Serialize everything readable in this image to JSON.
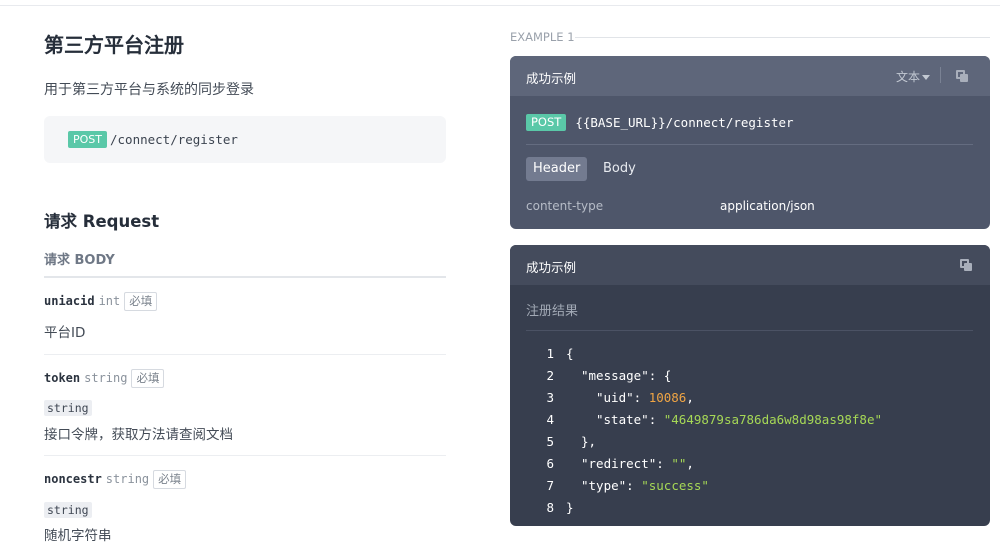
{
  "page": {
    "title": "第三方平台注册",
    "description": "用于第三方平台与系统的同步登录",
    "method": "POST",
    "path": "/connect/register",
    "request_title": "请求 Request",
    "body_label": "请求 BODY"
  },
  "params": [
    {
      "name": "uniacid",
      "type": "int",
      "required": "必填",
      "tag": "",
      "desc": "平台ID"
    },
    {
      "name": "token",
      "type": "string",
      "required": "必填",
      "tag": "string",
      "desc": "接口令牌，获取方法请查阅文档"
    },
    {
      "name": "noncestr",
      "type": "string",
      "required": "必填",
      "tag": "string",
      "desc": "随机字符串"
    }
  ],
  "example": {
    "label": "EXAMPLE 1",
    "card1": {
      "title": "成功示例",
      "format": "文本",
      "method": "POST",
      "url": "{{BASE_URL}}/connect/register",
      "tabs": [
        "Header",
        "Body"
      ],
      "header_key": "content-type",
      "header_value": "application/json"
    },
    "card2": {
      "title": "成功示例",
      "desc": "注册结果"
    }
  },
  "code_lines": [
    {
      "n": "1",
      "parts": [
        [
          "{",
          "k"
        ]
      ],
      "indent": 0
    },
    {
      "n": "2",
      "parts": [
        [
          "\"message\"",
          "k"
        ],
        [
          ": {",
          "k"
        ]
      ],
      "indent": 1
    },
    {
      "n": "3",
      "parts": [
        [
          "\"uid\"",
          "k"
        ],
        [
          ": ",
          "k"
        ],
        [
          "10086",
          "n"
        ],
        [
          ",",
          "k"
        ]
      ],
      "indent": 2
    },
    {
      "n": "4",
      "parts": [
        [
          "\"state\"",
          "k"
        ],
        [
          ": ",
          "k"
        ],
        [
          "\"4649879sa786da6w8d98as98f8e\"",
          "s"
        ]
      ],
      "indent": 2
    },
    {
      "n": "5",
      "parts": [
        [
          "},",
          "k"
        ]
      ],
      "indent": 1
    },
    {
      "n": "6",
      "parts": [
        [
          "\"redirect\"",
          "k"
        ],
        [
          ": ",
          "k"
        ],
        [
          "\"\"",
          "s"
        ],
        [
          ",",
          "k"
        ]
      ],
      "indent": 1
    },
    {
      "n": "7",
      "parts": [
        [
          "\"type\"",
          "k"
        ],
        [
          ": ",
          "k"
        ],
        [
          "\"success\"",
          "s"
        ]
      ],
      "indent": 1
    },
    {
      "n": "8",
      "parts": [
        [
          "}",
          "k"
        ]
      ],
      "indent": 0
    }
  ],
  "colors": {
    "method_green": "#5ac8a8",
    "number": "#f0a544",
    "string": "#a6d856",
    "card1_bg": "#4e566a",
    "card2_bg": "#373e4e"
  }
}
